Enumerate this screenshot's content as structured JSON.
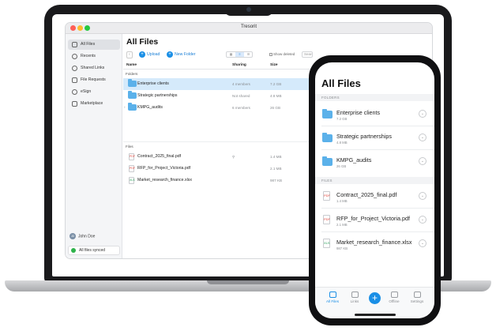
{
  "app": {
    "window_title": "Tresorit"
  },
  "sidebar": {
    "items": [
      {
        "label": "All Files",
        "icon": "folder-icon"
      },
      {
        "label": "Recents",
        "icon": "clock-icon"
      },
      {
        "label": "Shared Links",
        "icon": "link-icon"
      },
      {
        "label": "File Requests",
        "icon": "file-request-icon"
      },
      {
        "label": "eSign",
        "icon": "esign-icon"
      },
      {
        "label": "Marketplace",
        "icon": "marketplace-icon"
      }
    ],
    "user": {
      "initials": "JD",
      "name": "John Doe"
    },
    "sync_status": "All files synced"
  },
  "desktop": {
    "title": "All Files",
    "toolbar": {
      "back": "‹",
      "upload_label": "Upload",
      "new_folder_label": "New Folder",
      "show_deleted_label": "Show deleted",
      "search_placeholder": "Search"
    },
    "columns": {
      "name": "Name",
      "sharing": "Sharing",
      "size": "Size"
    },
    "folders_label": "Folders",
    "files_label": "Files",
    "folders": [
      {
        "name": "Enterprise clients",
        "sharing": "4 members",
        "size": "7.2 GB"
      },
      {
        "name": "Strategic partnerships",
        "sharing": "Not shared",
        "size": "4.8 MB"
      },
      {
        "name": "KMPG_audits",
        "sharing": "6 members",
        "size": "26 GB"
      }
    ],
    "files": [
      {
        "name": "Contract_2025_final.pdf",
        "sharing": "",
        "size": "1.4 MB",
        "type": "PDF"
      },
      {
        "name": "RFP_for_Project_Victoria.pdf",
        "sharing": "",
        "size": "2.1 MB",
        "type": "PDF"
      },
      {
        "name": "Market_research_finance.xlsx",
        "sharing": "",
        "size": "987 KB",
        "type": "XLS"
      }
    ]
  },
  "mobile": {
    "title": "All Files",
    "folders_label": "FOLDERS",
    "files_label": "FILES",
    "folders": [
      {
        "name": "Enterprise clients",
        "size": "7.2 GB"
      },
      {
        "name": "Strategic partnerships",
        "size": "4.8 MB"
      },
      {
        "name": "KMPG_audits",
        "size": "26 GB"
      }
    ],
    "files": [
      {
        "name": "Contract_2025_final.pdf",
        "size": "1.4 MB",
        "type": "PDF"
      },
      {
        "name": "RFP_for_Project_Victoria.pdf",
        "size": "2.1 MB",
        "type": "PDF"
      },
      {
        "name": "Market_research_finance.xlsx",
        "size": "987 KB",
        "type": "XLS"
      }
    ],
    "tabs": [
      {
        "label": "All Files"
      },
      {
        "label": "Links"
      },
      {
        "label": "Offline"
      },
      {
        "label": "Settings"
      }
    ],
    "fab_label": "+"
  },
  "colors": {
    "accent": "#1a8fe6",
    "folder": "#5bb1ea",
    "selected_row": "#d5eafb",
    "synced": "#2eb24b"
  }
}
